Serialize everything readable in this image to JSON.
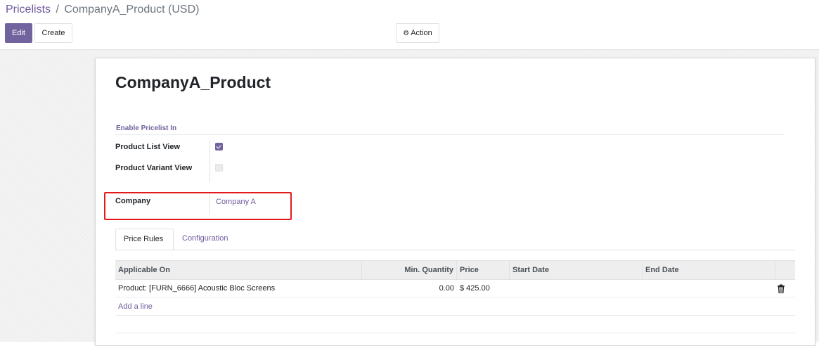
{
  "breadcrumb": {
    "parent": "Pricelists",
    "separator": "/",
    "current": "CompanyA_Product (USD)"
  },
  "toolbar": {
    "edit_label": "Edit",
    "create_label": "Create",
    "action_label": "Action",
    "action_icon": "gear-icon"
  },
  "form": {
    "name": "CompanyA_Product",
    "section_title": "Enable Pricelist In",
    "fields": {
      "product_list_view": {
        "label": "Product List View",
        "checked": true
      },
      "product_variant_view": {
        "label": "Product Variant View",
        "checked": false
      },
      "company": {
        "label": "Company",
        "value": "Company A"
      }
    }
  },
  "tabs": [
    {
      "label": "Price Rules",
      "active": true
    },
    {
      "label": "Configuration",
      "active": false
    }
  ],
  "table": {
    "columns": [
      "Applicable On",
      "Min. Quantity",
      "Price",
      "Start Date",
      "End Date"
    ],
    "rows": [
      {
        "applicable_on": "Product: [FURN_6666] Acoustic Bloc Screens",
        "min_quantity": "0.00",
        "price": "$ 425.00",
        "start_date": "",
        "end_date": "",
        "delete_icon": "trash-icon"
      }
    ],
    "add_line_label": "Add a line"
  },
  "colors": {
    "primary": "#71639e",
    "link": "#6f5a9c",
    "highlight_border": "#e31a1c"
  }
}
